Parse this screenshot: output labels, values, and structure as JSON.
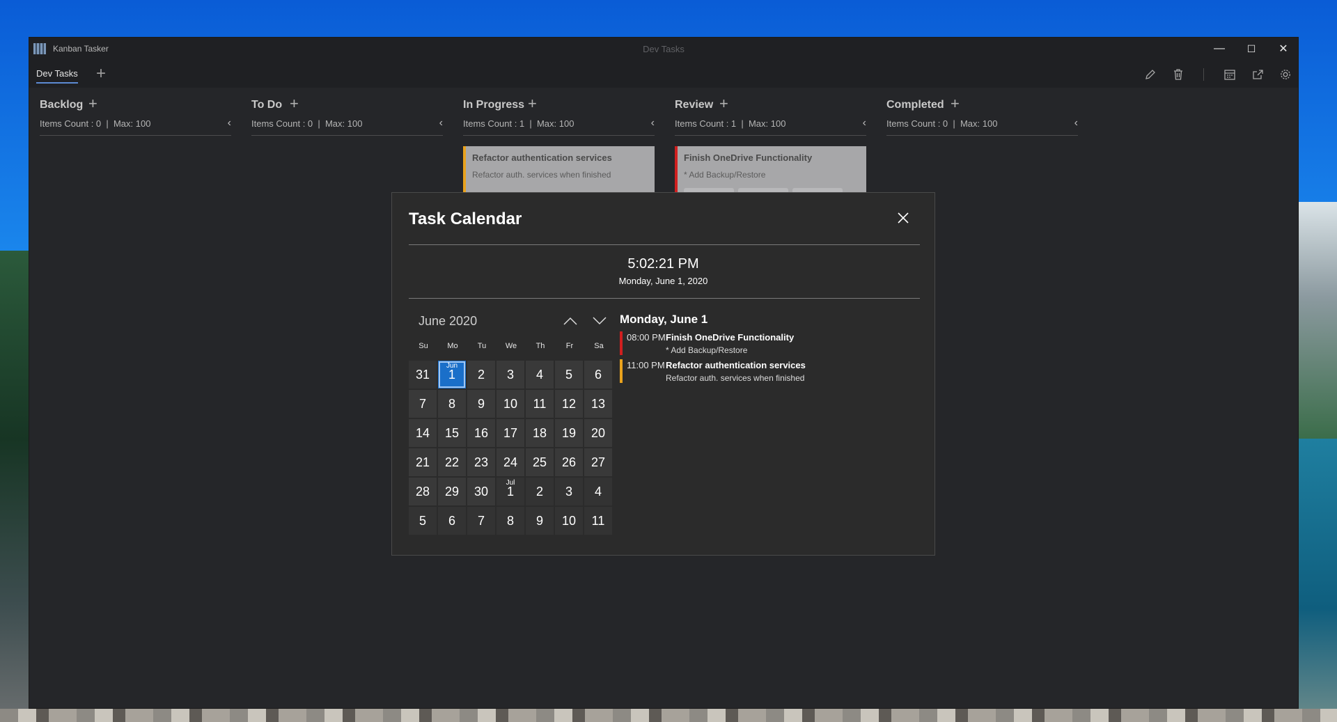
{
  "window": {
    "app_name": "Kanban Tasker",
    "board_title": "Dev Tasks",
    "controls": {
      "minimize": "—",
      "maximize": "☐",
      "close": "✕"
    }
  },
  "tabs": {
    "items": [
      {
        "label": "Dev Tasks"
      }
    ],
    "add_label": "+"
  },
  "toolbar": {
    "icons": [
      "edit-icon",
      "delete-icon",
      "calendar-icon",
      "export-icon",
      "settings-icon"
    ]
  },
  "columns": [
    {
      "title": "Backlog",
      "subtitle": "Items Count : 0  |  Max: 100",
      "add": "+",
      "collapse": "‹"
    },
    {
      "title": "To Do",
      "subtitle": "Items Count : 0  |  Max: 100",
      "add": "+",
      "collapse": "‹"
    },
    {
      "title": "In Progress",
      "subtitle": "Items Count : 1  |  Max: 100",
      "add": "+",
      "collapse": "‹"
    },
    {
      "title": "Review",
      "subtitle": "Items Count : 1  |  Max: 100",
      "add": "+",
      "collapse": "‹"
    },
    {
      "title": "Completed",
      "subtitle": "Items Count : 0  |  Max: 100",
      "add": "+",
      "collapse": "‹"
    }
  ],
  "cards": [
    {
      "title": "Refactor authentication services",
      "description": "Refactor auth. services when finished",
      "color": "#e9a21d"
    },
    {
      "title": "Finish OneDrive Functionality",
      "description": "* Add Backup/Restore",
      "color": "#d11f1f"
    }
  ],
  "dialog": {
    "title": "Task Calendar",
    "time": "5:02:21 PM",
    "date": "Monday, June 1, 2020",
    "calendar": {
      "month_label": "June 2020",
      "weekdays": [
        "Su",
        "Mo",
        "Tu",
        "We",
        "Th",
        "Fr",
        "Sa"
      ],
      "days": [
        {
          "d": "31",
          "other": true
        },
        {
          "d": "1",
          "label": "Jun",
          "selected": true
        },
        {
          "d": "2"
        },
        {
          "d": "3"
        },
        {
          "d": "4"
        },
        {
          "d": "5"
        },
        {
          "d": "6"
        },
        {
          "d": "7"
        },
        {
          "d": "8"
        },
        {
          "d": "9"
        },
        {
          "d": "10"
        },
        {
          "d": "11"
        },
        {
          "d": "12"
        },
        {
          "d": "13"
        },
        {
          "d": "14"
        },
        {
          "d": "15"
        },
        {
          "d": "16"
        },
        {
          "d": "17"
        },
        {
          "d": "18"
        },
        {
          "d": "19"
        },
        {
          "d": "20"
        },
        {
          "d": "21"
        },
        {
          "d": "22"
        },
        {
          "d": "23"
        },
        {
          "d": "24"
        },
        {
          "d": "25"
        },
        {
          "d": "26"
        },
        {
          "d": "27"
        },
        {
          "d": "28"
        },
        {
          "d": "29"
        },
        {
          "d": "30"
        },
        {
          "d": "1",
          "label": "Jul",
          "other": true
        },
        {
          "d": "2",
          "other": true
        },
        {
          "d": "3",
          "other": true
        },
        {
          "d": "4",
          "other": true
        },
        {
          "d": "5",
          "other": true
        },
        {
          "d": "6",
          "other": true
        },
        {
          "d": "7",
          "other": true
        },
        {
          "d": "8",
          "other": true
        },
        {
          "d": "9",
          "other": true
        },
        {
          "d": "10",
          "other": true
        },
        {
          "d": "11",
          "other": true
        }
      ]
    },
    "agenda": {
      "heading": "Monday, June 1",
      "events": [
        {
          "time": "08:00 PM",
          "title": "Finish OneDrive Functionality",
          "description": "* Add Backup/Restore",
          "color": "#d11f1f"
        },
        {
          "time": "11:00 PM",
          "title": "Refactor authentication services",
          "description": "Refactor auth. services when finished",
          "color": "#e9a21d"
        }
      ]
    }
  }
}
